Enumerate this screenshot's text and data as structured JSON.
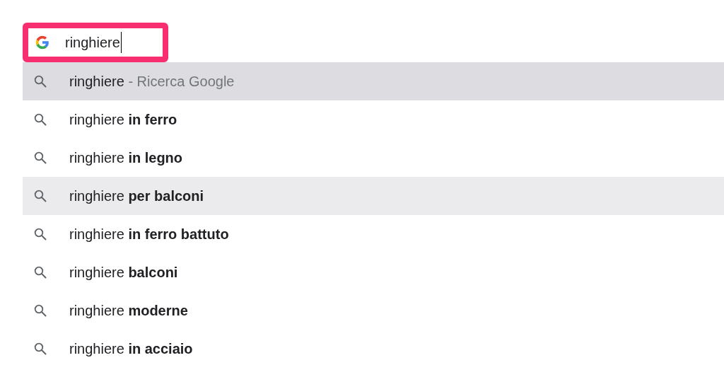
{
  "search": {
    "value": "ringhiere",
    "focused": true
  },
  "suggestions": [
    {
      "kind": "search",
      "query": "ringhiere",
      "completion": "- Ricerca Google",
      "selected": true,
      "hovered": false
    },
    {
      "kind": "suggestion",
      "query": "ringhiere",
      "completion": "in ferro",
      "selected": false,
      "hovered": false
    },
    {
      "kind": "suggestion",
      "query": "ringhiere",
      "completion": "in legno",
      "selected": false,
      "hovered": false
    },
    {
      "kind": "suggestion",
      "query": "ringhiere",
      "completion": "per balconi",
      "selected": false,
      "hovered": true
    },
    {
      "kind": "suggestion",
      "query": "ringhiere",
      "completion": "in ferro battuto",
      "selected": false,
      "hovered": false
    },
    {
      "kind": "suggestion",
      "query": "ringhiere",
      "completion": "balconi",
      "selected": false,
      "hovered": false
    },
    {
      "kind": "suggestion",
      "query": "ringhiere",
      "completion": "moderne",
      "selected": false,
      "hovered": false
    },
    {
      "kind": "suggestion",
      "query": "ringhiere",
      "completion": "in acciaio",
      "selected": false,
      "hovered": false
    }
  ]
}
